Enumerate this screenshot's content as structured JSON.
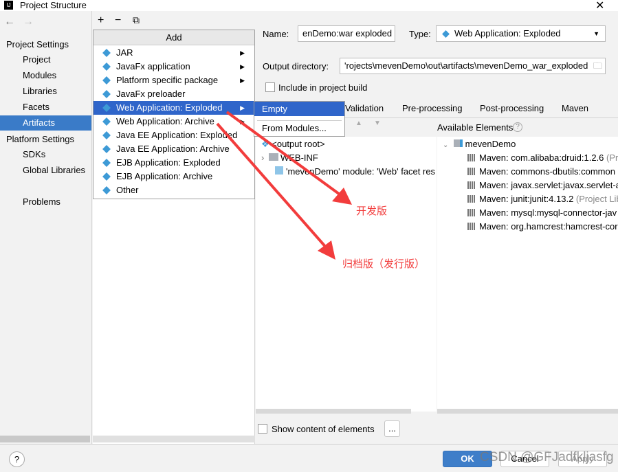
{
  "window": {
    "title": "Project Structure",
    "close": "✕"
  },
  "toolbar": {
    "add": "+",
    "remove": "−",
    "copy": "⧉",
    "back": "←",
    "forward": "→"
  },
  "sidebar": {
    "project_settings": "Project Settings",
    "items": [
      "Project",
      "Modules",
      "Libraries",
      "Facets",
      "Artifacts"
    ],
    "platform_settings": "Platform Settings",
    "platform_items": [
      "SDKs",
      "Global Libraries"
    ],
    "problems": "Problems",
    "selected": "Artifacts"
  },
  "add_menu": {
    "header": "Add",
    "items": [
      {
        "label": "JAR",
        "submenu": true
      },
      {
        "label": "JavaFx application",
        "submenu": true
      },
      {
        "label": "Platform specific package",
        "submenu": true
      },
      {
        "label": "JavaFx preloader",
        "submenu": false
      },
      {
        "label": "Web Application: Exploded",
        "submenu": true
      },
      {
        "label": "Web Application: Archive",
        "submenu": true
      },
      {
        "label": "Java EE Application: Exploded",
        "submenu": false
      },
      {
        "label": "Java EE Application: Archive",
        "submenu": false
      },
      {
        "label": "EJB Application: Exploded",
        "submenu": false
      },
      {
        "label": "EJB Application: Archive",
        "submenu": false
      },
      {
        "label": "Other",
        "submenu": false
      }
    ],
    "selected": "Web Application: Exploded",
    "submenu": [
      "Empty",
      "From Modules..."
    ]
  },
  "details": {
    "name_label": "Name:",
    "name_value": "enDemo:war exploded",
    "type_label": "Type:",
    "type_value": "Web Application: Exploded",
    "output_label": "Output directory:",
    "output_value": "'rojects\\mevenDemo\\out\\artifacts\\mevenDemo_war_exploded",
    "include_label": "Include in project build",
    "include_checked": false,
    "tabs": [
      "Validation",
      "Pre-processing",
      "Post-processing",
      "Maven"
    ],
    "available_label": "Available Elements",
    "output_tree": [
      "<output root>",
      "WEB-INF",
      "'mevenDemo' module: 'Web' facet res"
    ],
    "available_root": "mevenDemo",
    "available_items": [
      {
        "name": "Maven: com.alibaba:druid:1.2.6",
        "suffix": " (Pr"
      },
      {
        "name": "Maven: commons-dbutils:common",
        "suffix": ""
      },
      {
        "name": "Maven: javax.servlet:javax.servlet-a",
        "suffix": ""
      },
      {
        "name": "Maven: junit:junit:4.13.2",
        "suffix": " (Project Lib"
      },
      {
        "name": "Maven: mysql:mysql-connector-jav",
        "suffix": ""
      },
      {
        "name": "Maven: org.hamcrest:hamcrest-cor",
        "suffix": ""
      }
    ],
    "show_content_label": "Show content of elements",
    "ellipsis": "..."
  },
  "footer": {
    "help": "?",
    "ok": "OK",
    "cancel": "Cancel",
    "apply": "Apply"
  },
  "annotations": {
    "dev": "开发版",
    "archive": "归档版（发行版）",
    "color": "#f23c3c"
  },
  "watermark": "CSDN @GFJadfkljasfg"
}
